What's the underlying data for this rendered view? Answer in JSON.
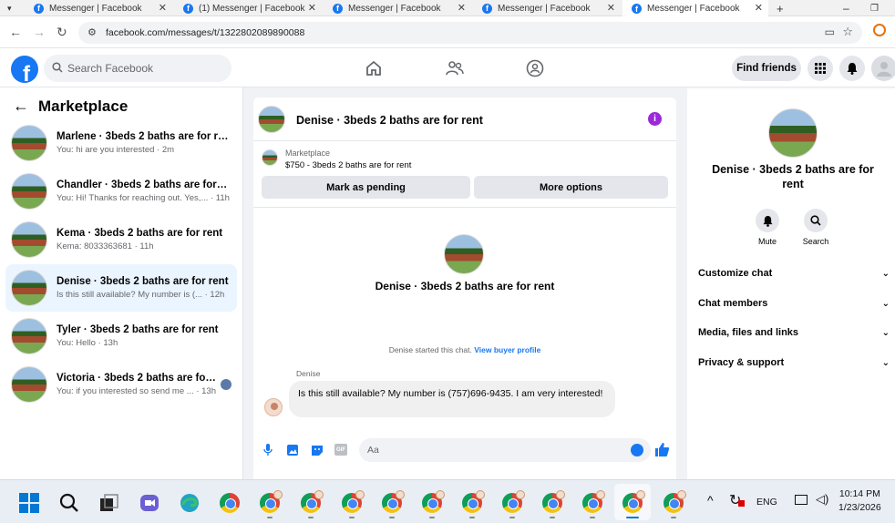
{
  "browser": {
    "tabs": [
      {
        "label": "Messenger | Facebook",
        "active": false
      },
      {
        "label": "(1) Messenger | Facebook",
        "active": false
      },
      {
        "label": "Messenger | Facebook",
        "active": false
      },
      {
        "label": "Messenger | Facebook",
        "active": false
      },
      {
        "label": "Messenger | Facebook",
        "active": true
      }
    ],
    "new_tab": "+",
    "url": "facebook.com/messages/t/1322802089890088"
  },
  "header": {
    "logo": "f",
    "search_placeholder": "Search Facebook",
    "find_friends": "Find friends"
  },
  "sidebar": {
    "title": "Marketplace",
    "conversations": [
      {
        "name": "Marlene · 3beds 2 baths are for rent",
        "preview": "You: hi are you interested · 2m",
        "selected": false
      },
      {
        "name": "Chandler · 3beds 2 baths are for re...",
        "preview": "You: Hi! Thanks for reaching out. Yes,... · 11h",
        "selected": false
      },
      {
        "name": "Kema · 3beds 2 baths are for rent",
        "preview": "Kema: 8033363681 · 11h",
        "selected": false
      },
      {
        "name": "Denise · 3beds 2 baths are for rent",
        "preview": "Is this still available? My number is (... · 12h",
        "selected": true
      },
      {
        "name": "Tyler · 3beds 2 baths are for rent",
        "preview": "You: Hello · 13h",
        "selected": false
      },
      {
        "name": "Victoria · 3beds 2 baths are for r...",
        "preview": "You: if you interested so send me ... · 13h",
        "selected": false
      }
    ]
  },
  "chat": {
    "title": "Denise · 3beds 2 baths are for rent",
    "marketplace_label": "Marketplace",
    "listing": "$750 - 3beds 2 baths are for rent",
    "mark_pending": "Mark as pending",
    "more_options": "More options",
    "center_name": "Denise · 3beds 2 baths are for rent",
    "started_text": "Denise started this chat.",
    "view_profile": "View buyer profile",
    "sender": "Denise",
    "message": "Is this still available? My number is (757)696-9435. I am very interested!",
    "composer_placeholder": "Aa",
    "gif": "GIF"
  },
  "details": {
    "name": "Denise · 3beds 2 baths are for rent",
    "mute": "Mute",
    "search": "Search",
    "sections": [
      "Customize chat",
      "Chat members",
      "Media, files and links",
      "Privacy & support"
    ]
  },
  "taskbar": {
    "lang": "ENG",
    "time": "10:14 PM",
    "date": "1/23/2026"
  },
  "colors": {
    "brand": "#1877f2",
    "selected_row": "#ebf5ff",
    "info": "#9b29db"
  }
}
